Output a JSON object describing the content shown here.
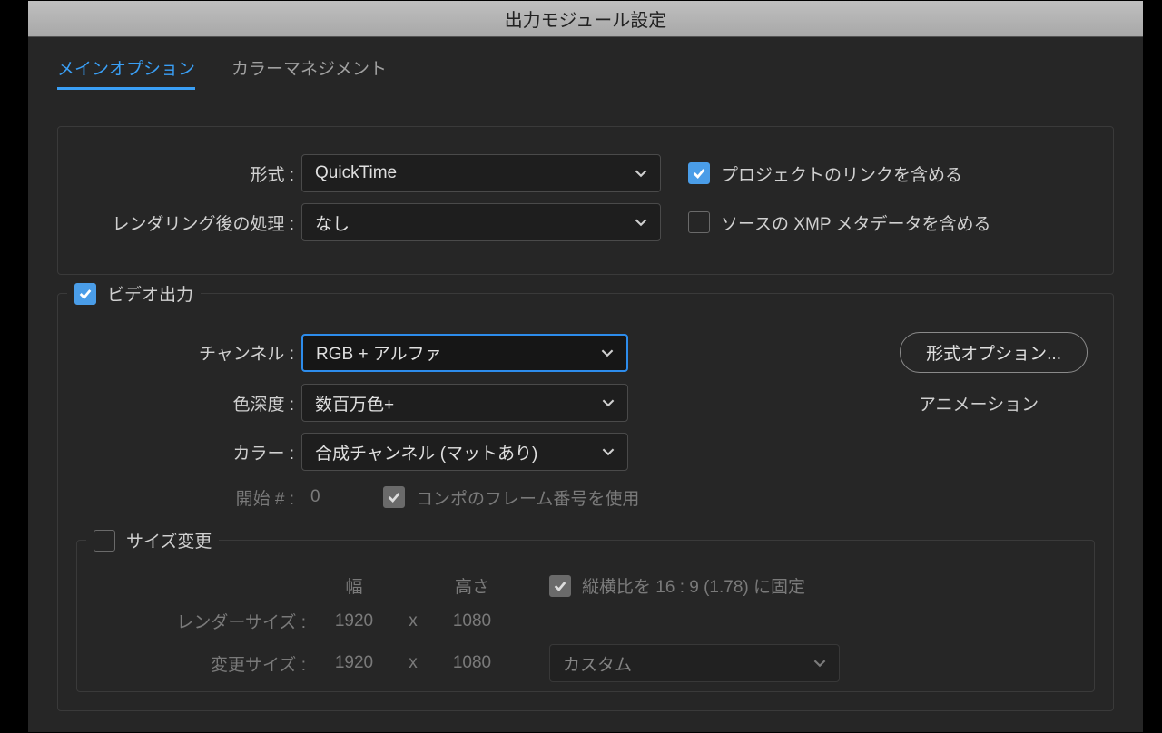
{
  "window": {
    "title": "出力モジュール設定"
  },
  "tabs": {
    "main": "メインオプション",
    "color_mgmt": "カラーマネジメント"
  },
  "top": {
    "format_label": "形式 :",
    "format_value": "QuickTime",
    "post_render_label": "レンダリング後の処理 :",
    "post_render_value": "なし",
    "include_project_link": "プロジェクトのリンクを含める",
    "include_xmp": "ソースの XMP メタデータを含める"
  },
  "video": {
    "section": "ビデオ出力",
    "channels_label": "チャンネル :",
    "channels_value": "RGB + アルファ",
    "depth_label": "色深度 :",
    "depth_value": "数百万色+",
    "color_label": "カラー :",
    "color_value": "合成チャンネル (マットあり)",
    "start_label": "開始 # :",
    "start_value": "0",
    "use_comp_frame": "コンポのフレーム番号を使用",
    "format_options_btn": "形式オプション...",
    "codec": "アニメーション"
  },
  "resize": {
    "section": "サイズ変更",
    "width_head": "幅",
    "height_head": "高さ",
    "lock_aspect": "縦横比を 16 : 9 (1.78) に固定",
    "render_label": "レンダーサイズ :",
    "render_w": "1920",
    "render_h": "1080",
    "resize_label": "変更サイズ :",
    "resize_w": "1920",
    "resize_h": "1080",
    "custom": "カスタム",
    "x": "x"
  }
}
